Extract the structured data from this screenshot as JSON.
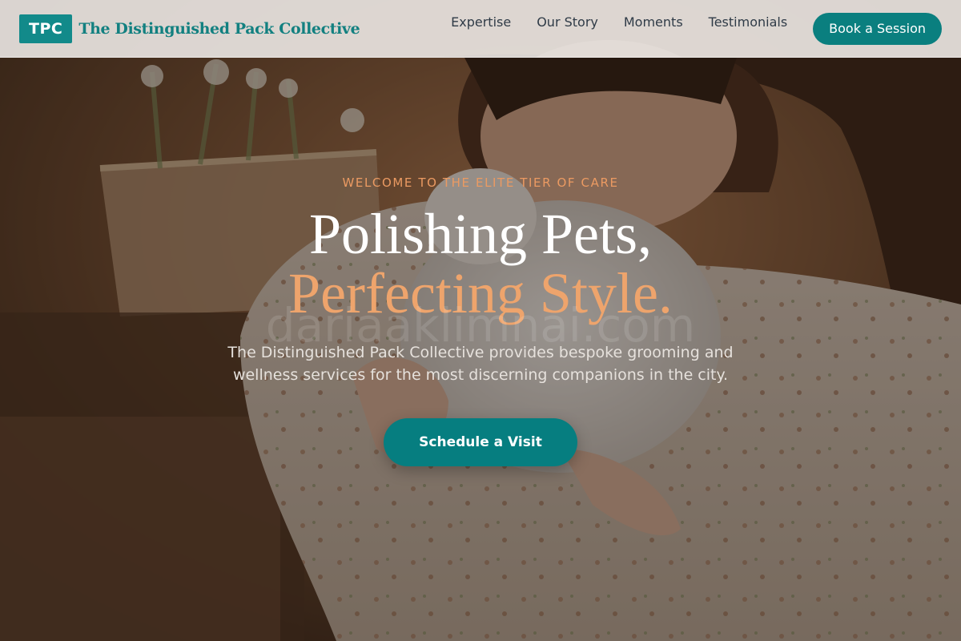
{
  "brand": {
    "badge": "TPC",
    "name": "The Distinguished Pack Collective"
  },
  "nav": {
    "items": [
      "Expertise",
      "Our Story",
      "Moments",
      "Testimonials"
    ],
    "cta_label": "Book a Session"
  },
  "hero": {
    "eyebrow": "WELCOME TO THE ELITE TIER OF CARE",
    "headline_line1": "Polishing Pets,",
    "headline_line2": "Perfecting Style.",
    "description": "The Distinguished Pack Collective provides bespoke grooming and wellness services for the most discerning companions in the city.",
    "cta_label": "Schedule a Visit",
    "image_subject": "woman-hugging-white-rabbit",
    "watermark": "dariaaklimnai.com"
  },
  "colors": {
    "accent": "#0a7f7f",
    "brand_text": "#128080",
    "highlight": "#eea46c",
    "header_bg": "#ece8e4"
  }
}
